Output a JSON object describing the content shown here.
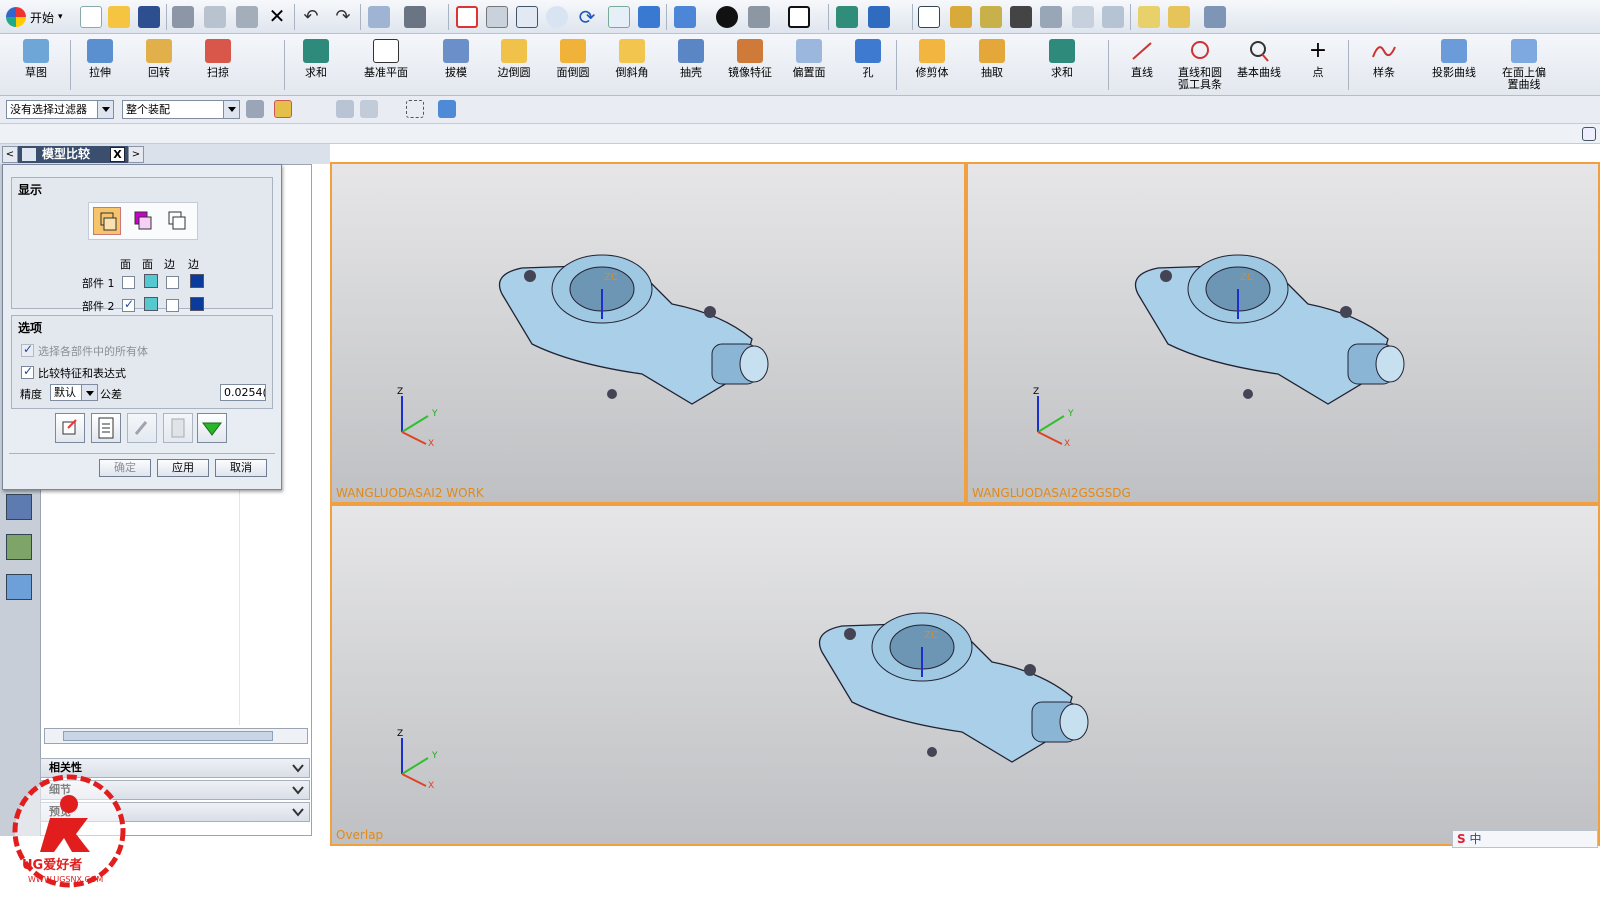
{
  "menu": {
    "start_label": "开始",
    "start_arrow": "▾"
  },
  "ribbon": {
    "buttons": [
      {
        "id": "sketch",
        "label": "草图"
      },
      {
        "id": "extrude",
        "label": "拉伸"
      },
      {
        "id": "revolve",
        "label": "回转"
      },
      {
        "id": "sweep",
        "label": "扫掠"
      },
      {
        "id": "unite1",
        "label": "求和"
      },
      {
        "id": "datum",
        "label": "基准平面"
      },
      {
        "id": "draft",
        "label": "拔模"
      },
      {
        "id": "edge-blend",
        "label": "边倒圆"
      },
      {
        "id": "face-blend",
        "label": "面倒圆"
      },
      {
        "id": "chamfer",
        "label": "倒斜角"
      },
      {
        "id": "shell",
        "label": "抽壳"
      },
      {
        "id": "mirror",
        "label": "镜像特征"
      },
      {
        "id": "offset-face",
        "label": "偏置面"
      },
      {
        "id": "hole",
        "label": "孔"
      },
      {
        "id": "trim-body",
        "label": "修剪体"
      },
      {
        "id": "extract",
        "label": "抽取"
      },
      {
        "id": "unite2",
        "label": "求和"
      },
      {
        "id": "line",
        "label": "直线"
      },
      {
        "id": "line-arc",
        "label": "直线和圆\n弧工具条"
      },
      {
        "id": "basic-curve",
        "label": "基本曲线"
      },
      {
        "id": "point",
        "label": "点"
      },
      {
        "id": "spline",
        "label": "样条"
      },
      {
        "id": "project-curve",
        "label": "投影曲线"
      },
      {
        "id": "offset-curve",
        "label": "在面上偏\n置曲线"
      }
    ]
  },
  "filters": {
    "selection_filter": "没有选择过滤器",
    "scope": "整个装配"
  },
  "resource_tab": {
    "title": "模型比较",
    "close": "X",
    "prev": "<",
    "next": ">"
  },
  "dialog": {
    "display_section": "显示",
    "col_headers": [
      "面",
      "面",
      "边",
      "边"
    ],
    "part1_label": "部件 1",
    "part2_label": "部件 2",
    "part1_colors": [
      "#56c8cf",
      "#0a3a9a"
    ],
    "part2_colors": [
      "#56c8cf",
      "#0a3a9a"
    ],
    "options_section": "选项",
    "opt_all_bodies": "选择各部件中的所有体",
    "opt_compare_features": "比较特征和表达式",
    "precision_label": "精度",
    "precision_value": "默认",
    "tolerance_label": "公差",
    "tolerance_value": "0.0254(",
    "ok": "确定",
    "apply": "应用",
    "cancel": "取消"
  },
  "panel_sections": [
    {
      "label": "相关性"
    },
    {
      "label": "细节"
    },
    {
      "label": "预览"
    }
  ],
  "viewports": [
    {
      "label": "WANGLUODASAI2 WORK"
    },
    {
      "label": "WANGLUODASAI2GSGSDG"
    },
    {
      "label": "Overlap"
    }
  ],
  "triad": {
    "x": "X",
    "y": "Y",
    "z": "Z",
    "zc": "ZC"
  },
  "watermark": {
    "brand": "UG爱好者",
    "url": "WWW.UGSNX.COM"
  },
  "ime": {
    "lang": "中"
  },
  "colors": {
    "viewport_border": "#f0a040",
    "part_blue": "#a9d0e8",
    "label_orange": "#e08a1a"
  }
}
